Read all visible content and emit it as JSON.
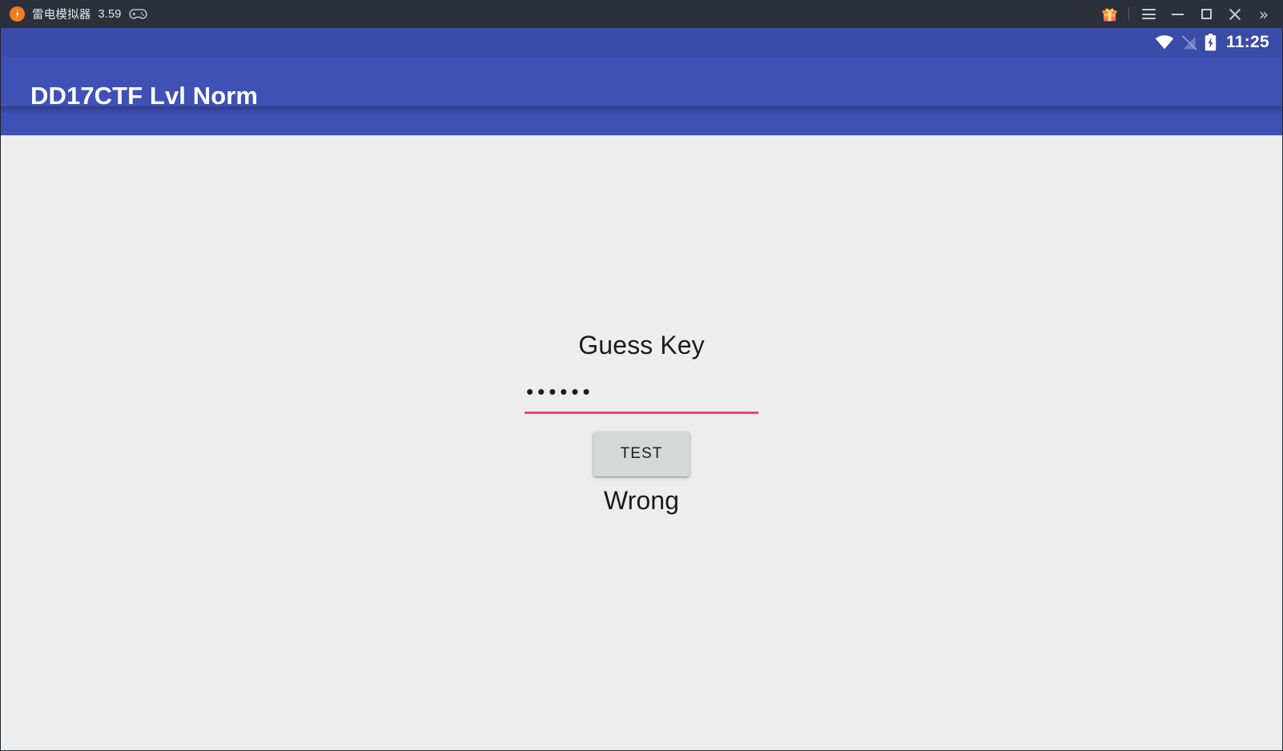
{
  "emulator": {
    "app_name": "雷电模拟器",
    "version": "3.59",
    "icons": {
      "logo": "ldplayer-logo-icon",
      "gamepad": "gamepad-icon",
      "gift": "gift-icon",
      "menu": "hamburger-menu-icon",
      "minimize": "minimize-icon",
      "maximize": "maximize-icon",
      "close": "close-icon",
      "expand": "double-chevron-right-icon"
    },
    "expand_glyph": "»"
  },
  "android": {
    "status_bar": {
      "clock": "11:25",
      "wifi": "wifi-icon",
      "signal": "no-sim-icon",
      "battery": "battery-charging-icon",
      "background_color": "#3b4ba8"
    },
    "app_bar": {
      "title": "DD17CTF Lvl Norm",
      "background_color": "#3f51b5"
    },
    "content": {
      "background_color": "#ededed",
      "guess_label": "Guess Key",
      "key_input": {
        "value": "••••••",
        "placeholder": "",
        "char_count": 6,
        "underline_color": "#f4407e",
        "type": "password"
      },
      "test_button_label": "TEST",
      "result_text": "Wrong"
    }
  }
}
